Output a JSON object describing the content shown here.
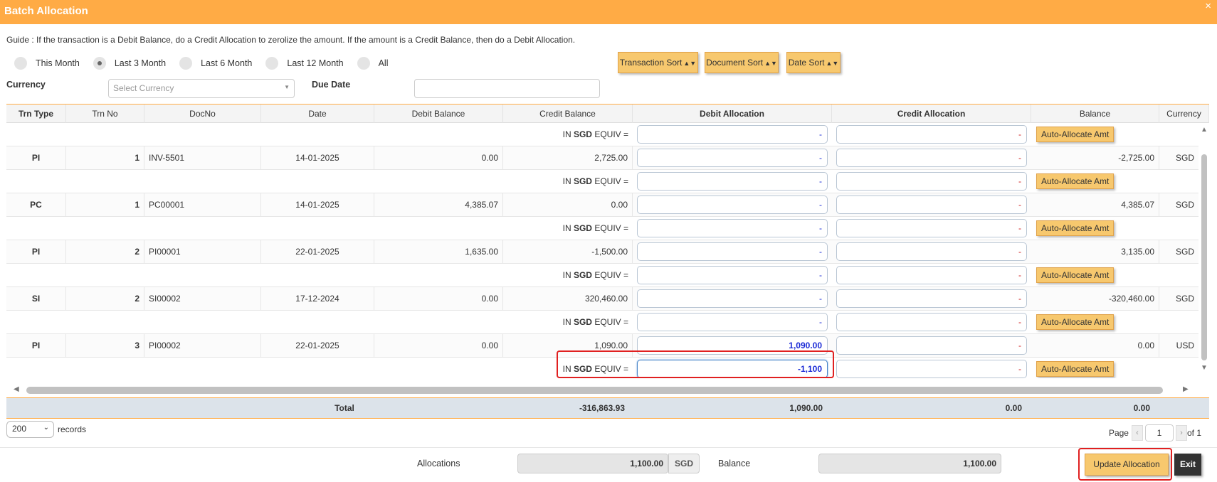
{
  "window": {
    "title": "Batch Allocation",
    "close": "×"
  },
  "guide": "Guide : If the transaction is a Debit Balance, do a Credit Allocation to zerolize the amount. If the amount is a Credit Balance, then do a Debit Allocation.",
  "period": {
    "options": [
      "This Month",
      "Last 3 Month",
      "Last 6 Month",
      "Last 12 Month",
      "All"
    ],
    "selected": "Last 3 Month"
  },
  "sort_buttons": [
    "Transaction Sort",
    "Document Sort",
    "Date Sort"
  ],
  "filters": {
    "currency_label": "Currency",
    "currency_placeholder": "Select Currency",
    "due_date_label": "Due Date",
    "due_date_value": ""
  },
  "columns": [
    "Trn Type",
    "Trn No",
    "DocNo",
    "Date",
    "Debit Balance",
    "Credit Balance",
    "Debit Allocation",
    "Credit Allocation",
    "Balance",
    "Currency"
  ],
  "equiv": {
    "prefix": "IN",
    "currency": "SGD",
    "suffix": "EQUIV ="
  },
  "auto_allocate_label": "Auto-Allocate Amt",
  "empty_alloc": "-",
  "rows": [
    {
      "type": "PI",
      "no": "1",
      "doc": "INV-5501",
      "date": "14-01-2025",
      "debit_bal": "0.00",
      "credit_bal": "2,725.00",
      "debit_alloc": "-",
      "credit_alloc": "-",
      "balance": "-2,725.00",
      "currency": "SGD",
      "equiv_debit": "-",
      "equiv_credit": "-"
    },
    {
      "type": "PC",
      "no": "1",
      "doc": "PC00001",
      "date": "14-01-2025",
      "debit_bal": "4,385.07",
      "credit_bal": "0.00",
      "debit_alloc": "-",
      "credit_alloc": "-",
      "balance": "4,385.07",
      "currency": "SGD",
      "equiv_debit": "-",
      "equiv_credit": "-"
    },
    {
      "type": "PI",
      "no": "2",
      "doc": "PI00001",
      "date": "22-01-2025",
      "debit_bal": "1,635.00",
      "credit_bal": "-1,500.00",
      "debit_alloc": "-",
      "credit_alloc": "-",
      "balance": "3,135.00",
      "currency": "SGD",
      "equiv_debit": "-",
      "equiv_credit": "-"
    },
    {
      "type": "SI",
      "no": "2",
      "doc": "SI00002",
      "date": "17-12-2024",
      "debit_bal": "0.00",
      "credit_bal": "320,460.00",
      "debit_alloc": "-",
      "credit_alloc": "-",
      "balance": "-320,460.00",
      "currency": "SGD",
      "equiv_debit": "-",
      "equiv_credit": "-"
    },
    {
      "type": "PI",
      "no": "3",
      "doc": "PI00002",
      "date": "22-01-2025",
      "debit_bal": "0.00",
      "credit_bal": "1,090.00",
      "debit_alloc": "1,090.00",
      "credit_alloc": "-",
      "balance": "0.00",
      "currency": "USD",
      "equiv_debit": "-1,100",
      "equiv_credit": "-"
    }
  ],
  "totals": {
    "label": "Total",
    "credit_balance": "-316,863.93",
    "debit_allocation": "1,090.00",
    "credit_allocation": "0.00",
    "balance": "0.00"
  },
  "records": {
    "value": "200",
    "label": "records"
  },
  "pager": {
    "label": "Page",
    "current": "1",
    "of": "of 1"
  },
  "footer": {
    "allocations_label": "Allocations",
    "allocations_value": "1,100.00",
    "allocations_currency": "SGD",
    "balance_label": "Balance",
    "balance_value": "1,100.00",
    "update_label": "Update Allocation",
    "exit_label": "Exit"
  },
  "colors": {
    "accent": "#ffab45",
    "button": "#f7c86e",
    "highlight": "#e02020",
    "debit_text": "#1a2ad6",
    "credit_text": "#d02020"
  }
}
